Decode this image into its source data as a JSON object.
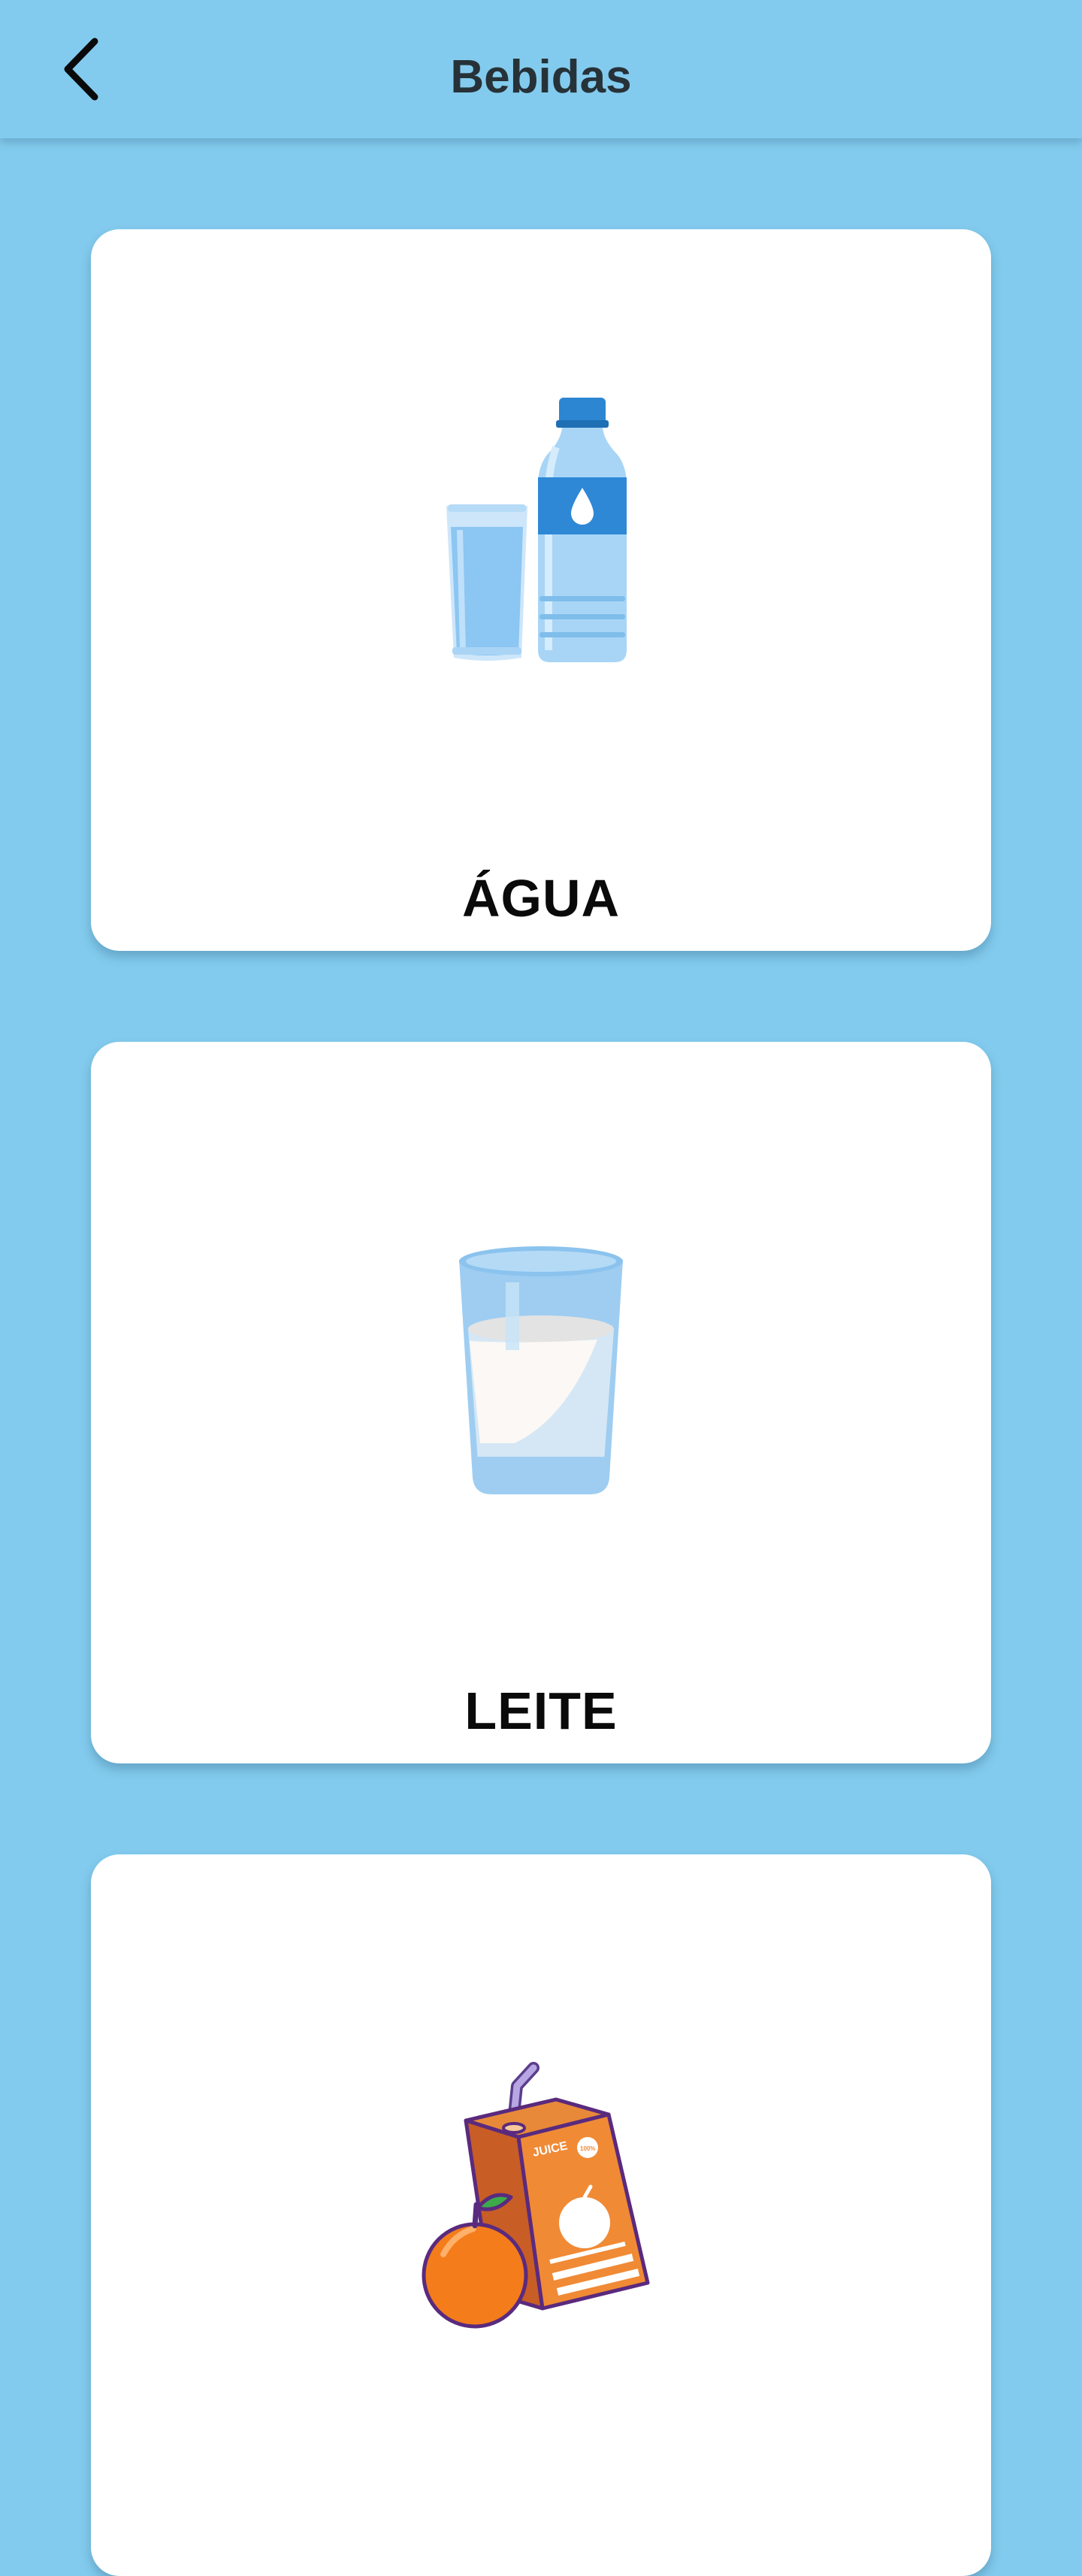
{
  "header": {
    "title": "Bebidas",
    "back_icon": "chevron-left-icon"
  },
  "cards": [
    {
      "label": "ÁGUA",
      "icon": "water-bottle-and-glass-icon"
    },
    {
      "label": "LEITE",
      "icon": "glass-of-milk-icon"
    },
    {
      "label": "",
      "icon": "juice-box-and-orange-icon"
    }
  ],
  "colors": {
    "background": "#83CBEE",
    "card": "#FFFFFF",
    "title": "#263238"
  }
}
